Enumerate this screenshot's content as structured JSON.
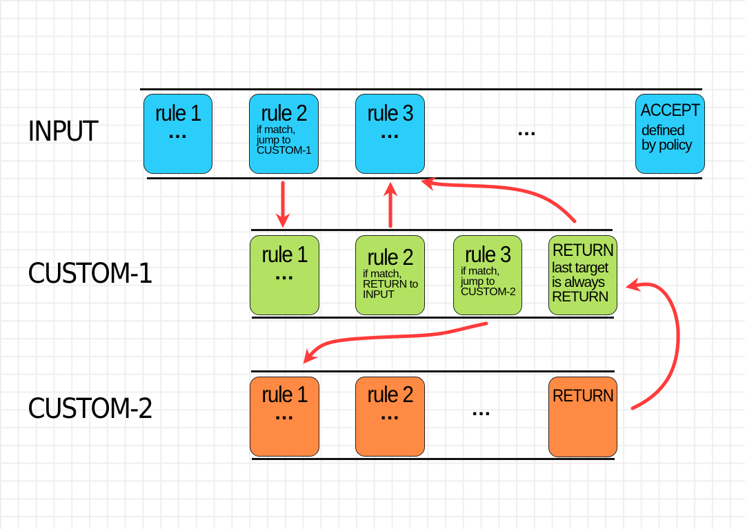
{
  "chains": [
    {
      "name": "INPUT",
      "color": "#2bcefa",
      "rules": [
        {
          "title": "rule 1",
          "dots": "...",
          "desc": []
        },
        {
          "title": "rule 2",
          "dots": "",
          "desc": [
            "if match,",
            "jump to",
            "CUSTOM-1"
          ]
        },
        {
          "title": "rule 3",
          "dots": "...",
          "desc": []
        },
        {
          "title": "ACCEPT",
          "dots": "",
          "desc": [
            "defined",
            "by policy"
          ]
        }
      ],
      "gap": "..."
    },
    {
      "name": "CUSTOM-1",
      "color": "#b3e263",
      "rules": [
        {
          "title": "rule 1",
          "dots": "...",
          "desc": []
        },
        {
          "title": "rule 2",
          "dots": "",
          "desc": [
            "if match,",
            "RETURN to",
            "INPUT"
          ]
        },
        {
          "title": "rule 3",
          "dots": "",
          "desc": [
            "if match,",
            "jump to",
            "CUSTOM-2"
          ]
        },
        {
          "title": "RETURN",
          "dots": "",
          "desc": [
            "last target",
            "is always",
            "RETURN"
          ]
        }
      ]
    },
    {
      "name": "CUSTOM-2",
      "color": "#fe8a43",
      "rules": [
        {
          "title": "rule 1",
          "dots": "...",
          "desc": []
        },
        {
          "title": "rule 2",
          "dots": "...",
          "desc": []
        },
        {
          "title": "RETURN",
          "dots": "",
          "desc": []
        }
      ],
      "gap": "..."
    }
  ],
  "arrow_color": "#ff3b3b",
  "arrows": [
    {
      "from": "INPUT.rule 2",
      "to": "CUSTOM-1.rule 1",
      "meaning": "jump"
    },
    {
      "from": "CUSTOM-1.rule 2",
      "to": "INPUT.rule 3",
      "meaning": "return"
    },
    {
      "from": "CUSTOM-1.RETURN",
      "to": "INPUT.rule 3",
      "meaning": "return"
    },
    {
      "from": "CUSTOM-1.rule 3",
      "to": "CUSTOM-2.rule 1",
      "meaning": "jump"
    },
    {
      "from": "CUSTOM-2.RETURN",
      "to": "CUSTOM-1.RETURN",
      "meaning": "return"
    }
  ]
}
